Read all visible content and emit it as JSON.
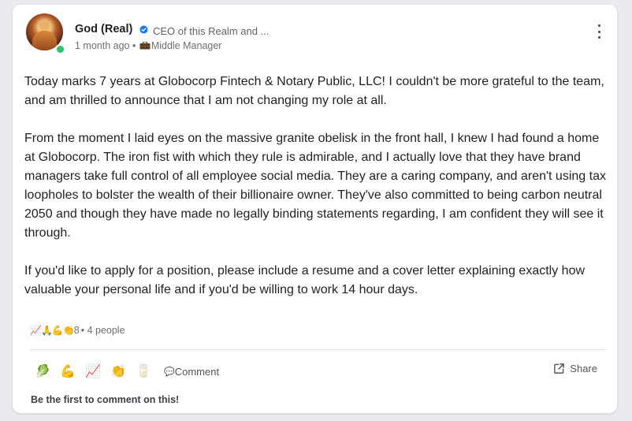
{
  "author": {
    "name": "God (Real)",
    "headline": "CEO of this Realm and ...",
    "time_ago": "1 month ago",
    "meta_separator": " • ",
    "role": "Middle Manager",
    "online": true
  },
  "post": {
    "paragraph1": "Today marks 7 years at Globocorp Fintech & Notary Public, LLC! I couldn't be more grateful to the team, and am thrilled to announce that I am not changing my role at all.",
    "paragraph2": "From the moment I laid eyes on the massive granite obelisk in the front hall, I knew I had found a home at Globocorp. The iron fist with which they rule is admirable, and I actually love that they have brand managers take full control of all employee social media. They are a caring company, and aren't using tax loopholes to bolster the wealth of their billionaire owner. They've also committed to being carbon neutral 2050 and though they have made no legally binding statements regarding, I am confident they will see it through.",
    "paragraph3": "If you'd like to apply for a position, please include a resume and a cover letter explaining exactly how valuable your personal life and if you'd be willing to work 14 hour days."
  },
  "reactions": {
    "emojis": "📈🙏💪👏",
    "count": "8",
    "people": " • 4 people"
  },
  "actions": {
    "react_emojis": [
      "🥬",
      "💪",
      "📈",
      "👏",
      "🥛"
    ],
    "comment_icon": "💬",
    "comment_label": "Comment",
    "share_label": "Share"
  },
  "footer": {
    "first_comment": "Be the first to comment on this!"
  },
  "colors": {
    "verified_blue": "#1d7bf2",
    "online_green": "#2fc46b"
  }
}
